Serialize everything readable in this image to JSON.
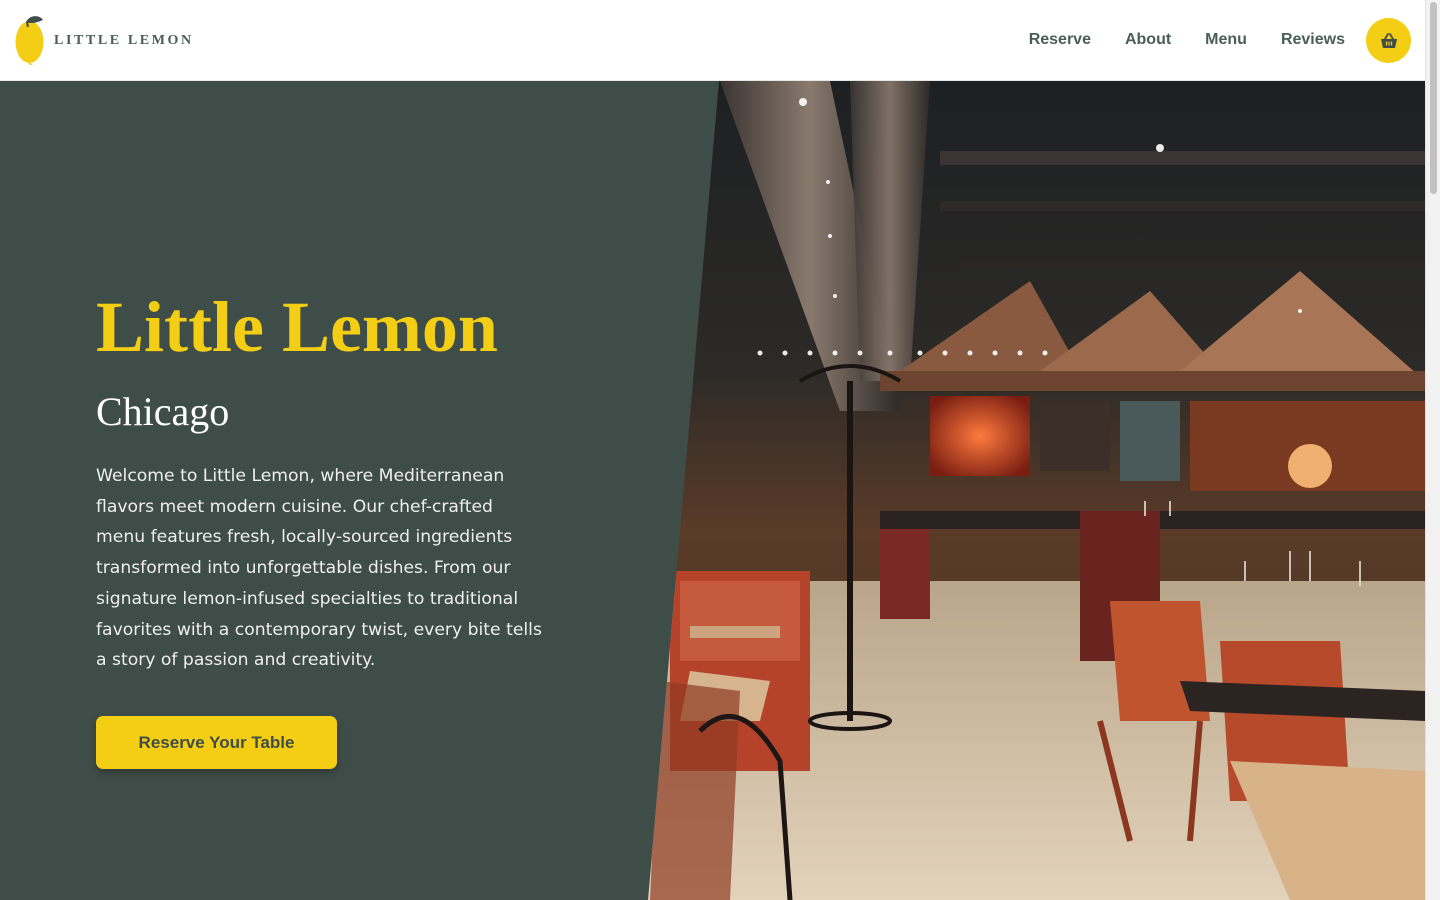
{
  "header": {
    "logo_text": "LITTLE LEMON",
    "nav": [
      "Reserve",
      "About",
      "Menu",
      "Reviews"
    ],
    "cart_icon": "basket-icon"
  },
  "hero": {
    "title": "Little Lemon",
    "subtitle": "Chicago",
    "description": "Welcome to Little Lemon, where Mediterranean flavors meet modern cuisine. Our chef-crafted menu features fresh, locally-sourced ingredients transformed into unforgettable dishes. From our signature lemon-infused specialties to traditional favorites with a contemporary twist, every bite tells a story of passion and creativity.",
    "cta_label": "Reserve Your Table",
    "image": "restaurant-interior-photo"
  },
  "colors": {
    "primary_green": "#3f4d48",
    "accent_yellow": "#f4ce14",
    "nav_text": "#495e57"
  }
}
